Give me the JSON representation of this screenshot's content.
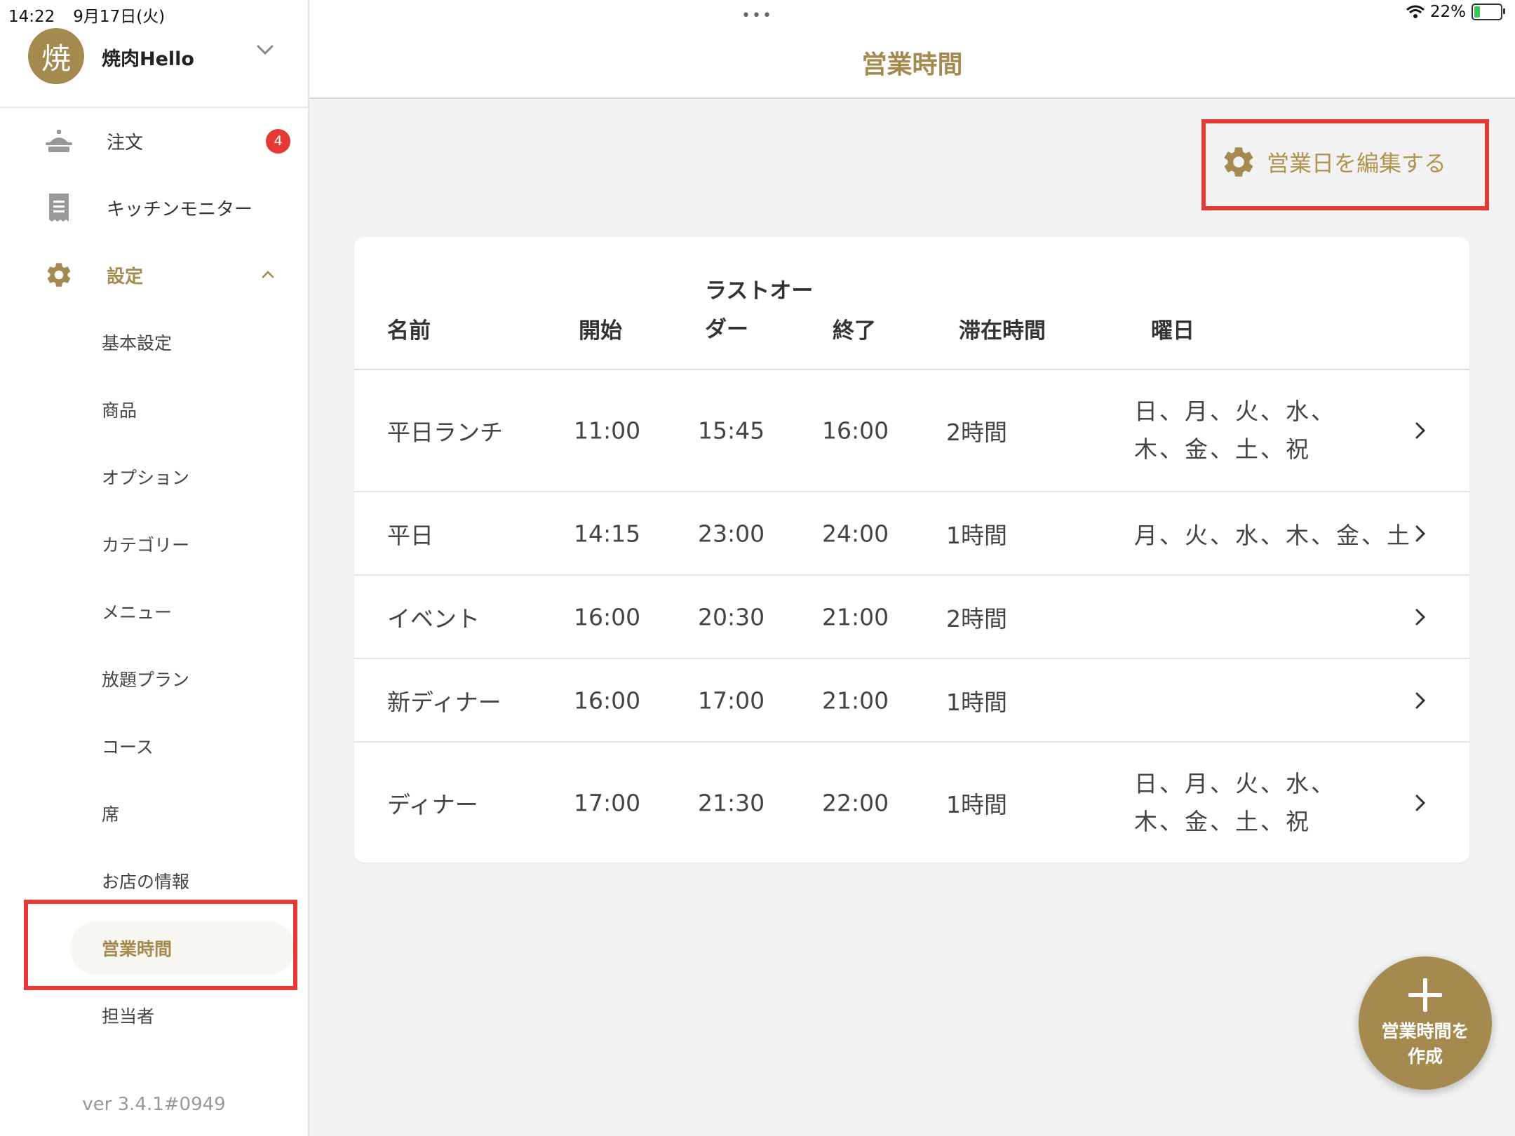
{
  "status_bar": {
    "time": "14:22",
    "date": "9月17日(火)",
    "battery": "22%",
    "battery_level": 0.22
  },
  "store": {
    "avatar_text": "焼",
    "name": "焼肉Hello"
  },
  "nav": {
    "orders": {
      "label": "注文",
      "badge": "4"
    },
    "kitchen": {
      "label": "キッチンモニター"
    },
    "settings": {
      "label": "設定"
    }
  },
  "settings_menu": [
    "基本設定",
    "商品",
    "オプション",
    "カテゴリー",
    "メニュー",
    "放題プラン",
    "コース",
    "席",
    "お店の情報",
    "営業時間",
    "担当者"
  ],
  "version": "ver 3.4.1#0949",
  "page": {
    "title": "営業時間"
  },
  "edit_days_label": "営業日を編集する",
  "table": {
    "headers": {
      "name": "名前",
      "start": "開始",
      "last_order_1": "ラストオー",
      "last_order_2": "ダー",
      "end": "終了",
      "stay": "滞在時間",
      "days": "曜日"
    },
    "rows": [
      {
        "name": "平日ランチ",
        "start": "11:00",
        "last_order": "15:45",
        "end": "16:00",
        "stay": "2時間",
        "days": "日、月、火、水、木、金、土、祝"
      },
      {
        "name": "平日",
        "start": "14:15",
        "last_order": "23:00",
        "end": "24:00",
        "stay": "1時間",
        "days": "月、火、水、木、金、土"
      },
      {
        "name": "イベント",
        "start": "16:00",
        "last_order": "20:30",
        "end": "21:00",
        "stay": "2時間",
        "days": ""
      },
      {
        "name": "新ディナー",
        "start": "16:00",
        "last_order": "17:00",
        "end": "21:00",
        "stay": "1時間",
        "days": ""
      },
      {
        "name": "ディナー",
        "start": "17:00",
        "last_order": "21:30",
        "end": "22:00",
        "stay": "1時間",
        "days": "日、月、火、水、木、金、土、祝"
      }
    ]
  },
  "fab": {
    "label_line1": "営業時間を",
    "label_line2": "作成"
  },
  "colors": {
    "accent": "#a58a4f",
    "badge": "#e53935",
    "highlight": "#e53935"
  }
}
